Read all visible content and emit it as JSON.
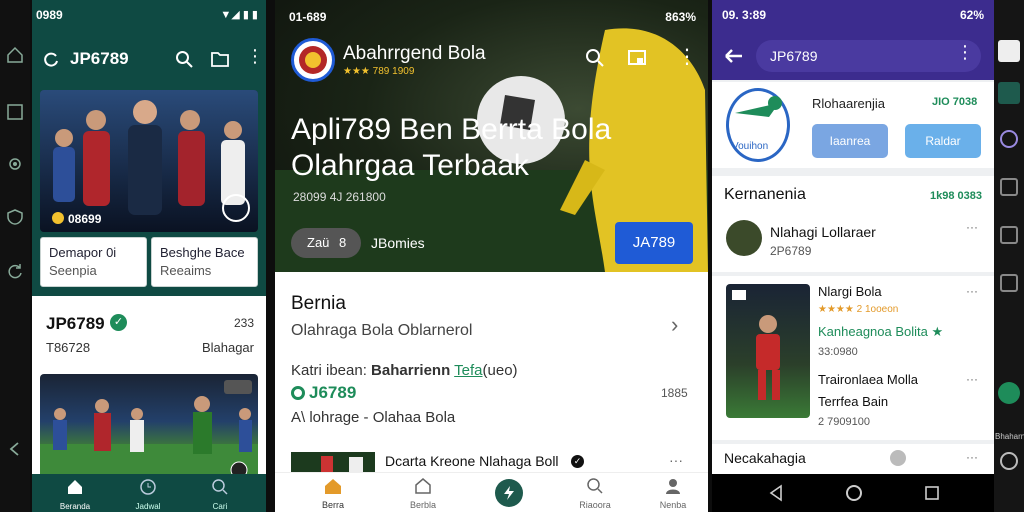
{
  "left_edge": {
    "icons": [
      "home-icon",
      "square-icon",
      "settings-icon",
      "shield-icon",
      "refresh-icon",
      "back-icon"
    ]
  },
  "screen1": {
    "status_time": "0989",
    "app_title": "JP6789",
    "cards": [
      {
        "line1": "Demapor 0i",
        "line2": "Seenpia"
      },
      {
        "line1": "Beshghe Bace",
        "line2": "Reeaims"
      }
    ],
    "badge_text": "08699",
    "profile_name": "JP6789",
    "profile_count": "233",
    "profile_id": "T86728",
    "profile_sub": "Blahagar",
    "bottom_nav": [
      "Beranda",
      "Jadwal",
      "Cari"
    ]
  },
  "screen2": {
    "status_time": "01-689",
    "battery": "863%",
    "brand_name": "Abahrrgend Bola",
    "brand_rating": "★★★ 789 1909",
    "hero_title_1": "Apli789 Ben Berrta Bola",
    "hero_title_2": "Olahrgaa Terbaak",
    "hero_meta": "28099 4J 261800",
    "chip_count": "Zaü",
    "chip_num": "8",
    "chip_label": "JBomies",
    "cta_label": "JA789",
    "section_title": "Bernia",
    "section_sub": "Olahraga Bola Oblarnerol",
    "row_prefix": "Katri ibean: ",
    "row_bold": "Baharrienn",
    "row_link": "Tefa",
    "row_suffix": "(ueo)",
    "brand_id": "J6789",
    "row_count": "1885",
    "row_desc": "A\\ lohrage - Olahaa Bola",
    "news_title": "Dcarta Kreone Nlahaga Boll",
    "bottom_nav": [
      "Berra",
      "Berbla",
      "",
      "Riaoora",
      "Nenba"
    ]
  },
  "screen3": {
    "status_time": "09. 3:89",
    "battery": "62%",
    "search_text": "JP6789",
    "logo_text": "Vouihon",
    "promo_title": "Rlohaarenjia",
    "promo_value": "JIO 7038",
    "btn_left": "Iaanrea",
    "btn_right": "Raldar",
    "section_title": "Kernanenia",
    "section_value": "1k98 0383",
    "item1_title": "Nlahagi Lollaraer",
    "item1_sub": "2P6789",
    "item2_title": "Nlargi Bola",
    "item2_rating": "★★★★ 2 1ooeon",
    "item2_link": "Kanheagnoa Bolita ★",
    "item2_code": "33:0980",
    "item3_title": "Traironlaea Molla",
    "item3_sub": "Terrfea Bain",
    "item3_code": "2 7909100",
    "item4_title": "Necakahagia"
  },
  "right_edge": {
    "label": "Bhaharn"
  },
  "colors": {
    "green": "#0f4a43",
    "purple": "#3c2c8e",
    "blue": "#1f5bd6",
    "accent_green": "#1e8c5a"
  }
}
